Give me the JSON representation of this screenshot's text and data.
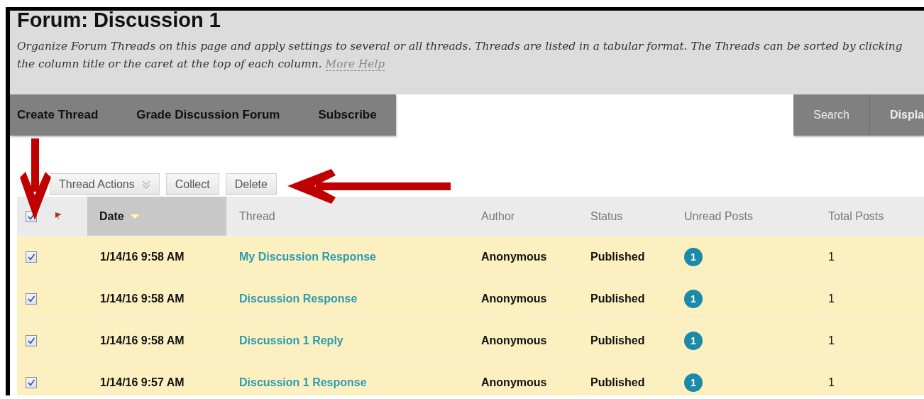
{
  "page": {
    "title": "Forum: Discussion 1",
    "description": "Organize Forum Threads on this page and apply settings to several or all threads. Threads are listed in a tabular format. The Threads can be sorted by clicking the column title or the caret at the top of each column.",
    "help_link": "More Help"
  },
  "action_bar": {
    "left": [
      "Create Thread",
      "Grade Discussion Forum",
      "Subscribe"
    ],
    "right": [
      "Search",
      "Displa"
    ]
  },
  "toolbar": [
    {
      "label": "Thread Actions",
      "kind": "menu"
    },
    {
      "label": "Collect",
      "kind": "button"
    },
    {
      "label": "Delete",
      "kind": "button"
    }
  ],
  "table": {
    "select_all": {
      "checked": true
    },
    "columns": [
      {
        "label": "Date",
        "sorted": true
      },
      {
        "label": "Thread",
        "sorted": false
      },
      {
        "label": "Author",
        "sorted": false
      },
      {
        "label": "Status",
        "sorted": false
      },
      {
        "label": "Unread Posts",
        "sorted": false
      },
      {
        "label": "Total Posts",
        "sorted": false
      }
    ],
    "rows": [
      {
        "checked": true,
        "date": "1/14/16 9:58 AM",
        "thread": "My Discussion Response",
        "author": "Anonymous",
        "status": "Published",
        "unread": "1",
        "total": "1"
      },
      {
        "checked": true,
        "date": "1/14/16 9:58 AM",
        "thread": "Discussion Response",
        "author": "Anonymous",
        "status": "Published",
        "unread": "1",
        "total": "1"
      },
      {
        "checked": true,
        "date": "1/14/16 9:58 AM",
        "thread": "Discussion 1 Reply",
        "author": "Anonymous",
        "status": "Published",
        "unread": "1",
        "total": "1"
      },
      {
        "checked": true,
        "date": "1/14/16 9:57 AM",
        "thread": "Discussion 1 Response",
        "author": "Anonymous",
        "status": "Published",
        "unread": "1",
        "total": "1"
      }
    ]
  }
}
